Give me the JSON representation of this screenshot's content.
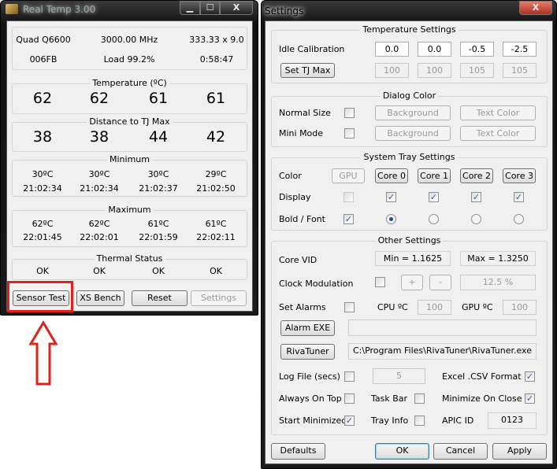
{
  "realtemp": {
    "title": "Real Temp 3.00",
    "controls": {
      "minimize": "▁",
      "maximize": "☐",
      "close": "X"
    },
    "cpu": "Quad Q6600",
    "freq": "3000.00 MHz",
    "multiplier": "333.33 x 9.0",
    "stepping": "006FB",
    "load": "Load  99.2%",
    "uptime": "0:58:47",
    "temperature": {
      "label": "Temperature (ºC)",
      "values": [
        "62",
        "62",
        "61",
        "61"
      ]
    },
    "distance": {
      "label": "Distance to TJ Max",
      "values": [
        "38",
        "38",
        "44",
        "42"
      ]
    },
    "minimum": {
      "label": "Minimum",
      "temps": [
        "30ºC",
        "30ºC",
        "30ºC",
        "29ºC"
      ],
      "times": [
        "21:02:34",
        "21:02:34",
        "21:02:37",
        "21:02:50"
      ]
    },
    "maximum": {
      "label": "Maximum",
      "temps": [
        "62ºC",
        "62ºC",
        "61ºC",
        "61ºC"
      ],
      "times": [
        "22:01:45",
        "22:02:01",
        "22:01:59",
        "22:02:11"
      ]
    },
    "thermal": {
      "label": "Thermal Status",
      "values": [
        "OK",
        "OK",
        "OK",
        "OK"
      ]
    },
    "buttons": {
      "sensor_test": "Sensor Test",
      "xs_bench": "XS Bench",
      "reset": "Reset",
      "settings": "Settings"
    }
  },
  "highlight_color": "#e0201c",
  "settings": {
    "title": "Settings",
    "close": "X",
    "temp_settings": {
      "label": "Temperature Settings",
      "idle_label": "Idle Calibration",
      "idle": [
        "0.0",
        "0.0",
        "-0.5",
        "-2.5"
      ],
      "set_tj": "Set TJ Max",
      "tj": [
        "100",
        "100",
        "105",
        "105"
      ]
    },
    "dialog_color": {
      "label": "Dialog Color",
      "normal": "Normal Size",
      "mini": "Mini Mode",
      "background": "Background",
      "text_color": "Text Color"
    },
    "tray": {
      "label": "System Tray Settings",
      "color": "Color",
      "display": "Display",
      "bold": "Bold / Font",
      "gpu": "GPU",
      "cores": [
        "Core 0",
        "Core 1",
        "Core 2",
        "Core 3"
      ]
    },
    "other": {
      "label": "Other Settings",
      "core_vid": "Core VID",
      "vid_min": "Min = 1.1625",
      "vid_max": "Max = 1.3250",
      "clock_mod": "Clock Modulation",
      "plus": "+",
      "minus": "-",
      "clock_pct": "12.5 %",
      "set_alarms": "Set Alarms",
      "cpu_c": "CPU ºC",
      "cpu_val": "100",
      "gpu_c": "GPU ºC",
      "gpu_val": "100",
      "alarm_exe": "Alarm EXE",
      "alarm_path": "",
      "rivatuner": "RivaTuner",
      "riva_path": "C:\\Program Files\\RivaTuner\\RivaTuner.exe",
      "log_file": "Log File (secs)",
      "log_val": "5",
      "excel": "Excel .CSV Format",
      "always_top": "Always On Top",
      "task_bar": "Task Bar",
      "min_close": "Minimize On Close",
      "start_min": "Start Minimized",
      "tray_info": "Tray Info",
      "apic": "APIC ID",
      "apic_val": "0123"
    },
    "buttons": {
      "defaults": "Defaults",
      "ok": "OK",
      "cancel": "Cancel",
      "apply": "Apply"
    }
  }
}
